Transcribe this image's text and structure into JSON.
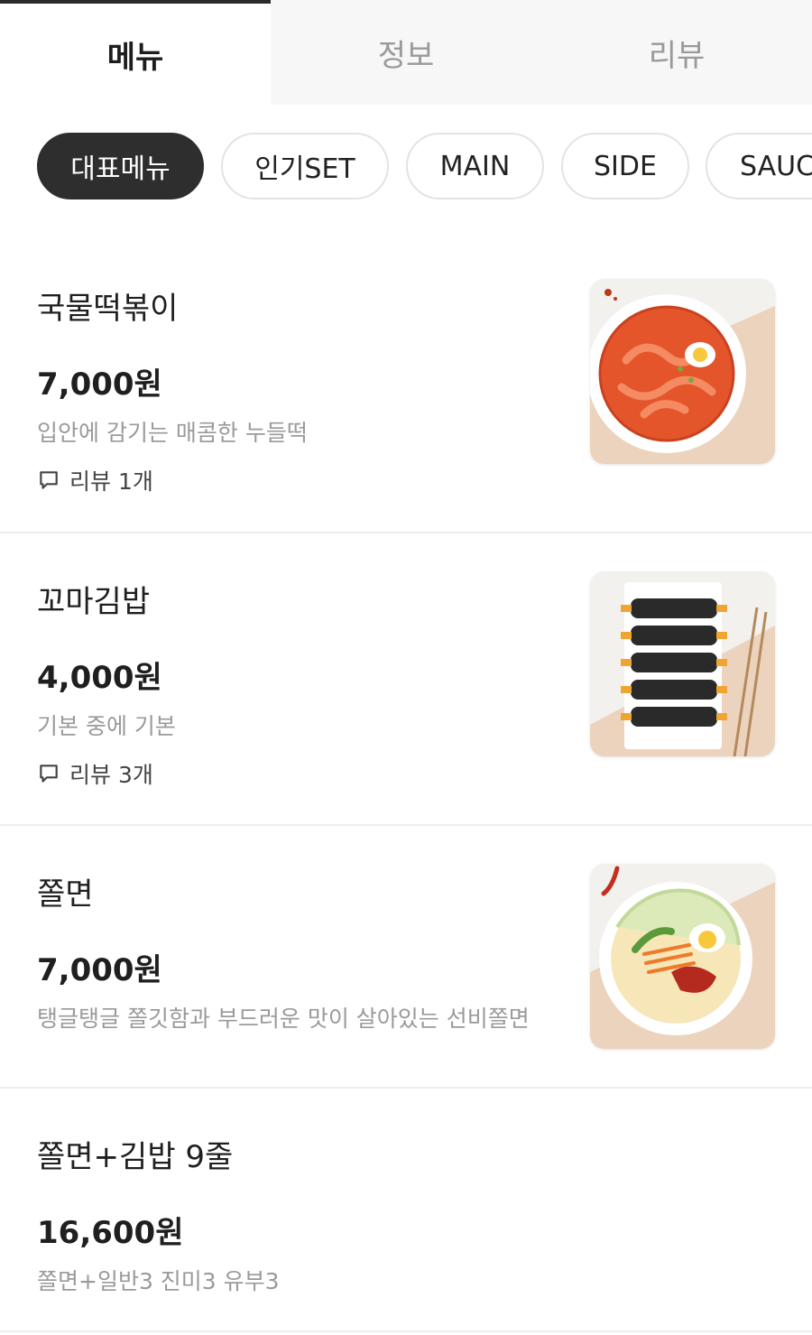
{
  "tabs": [
    {
      "label": "메뉴",
      "active": true
    },
    {
      "label": "정보",
      "active": false
    },
    {
      "label": "리뷰",
      "active": false
    }
  ],
  "categories": [
    {
      "label": "대표메뉴",
      "active": true
    },
    {
      "label": "인기SET",
      "active": false
    },
    {
      "label": "MAIN",
      "active": false
    },
    {
      "label": "SIDE",
      "active": false
    },
    {
      "label": "SAUCE",
      "active": false
    }
  ],
  "menu_items": [
    {
      "name": "국물떡볶이",
      "price": "7,000원",
      "description": "입안에 감기는 매콤한 누들떡",
      "review": "리뷰 1개",
      "image": "tteokbokki-photo"
    },
    {
      "name": "꼬마김밥",
      "price": "4,000원",
      "description": "기본 중에 기본",
      "review": "리뷰 3개",
      "image": "mini-gimbap-photo"
    },
    {
      "name": "쫄면",
      "price": "7,000원",
      "description": "탱글탱글 쫄깃함과 부드러운 맛이 살아있는 선비쫄면",
      "image": "jjolmyeon-photo"
    },
    {
      "name": "쫄면+김밥 9줄",
      "price": "16,600원",
      "description": "쫄면+일반3 진미3 유부3"
    }
  ],
  "colors": {
    "active_chip": "#2e2e2e",
    "tab_inactive_bg": "#f7f7f7",
    "muted_text": "#9a9a9a",
    "divider": "#eeeeee"
  }
}
